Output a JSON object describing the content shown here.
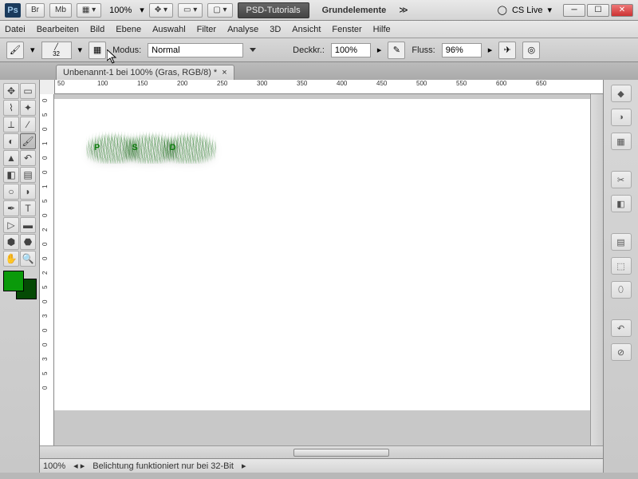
{
  "app": {
    "zoom": "100%",
    "workspace1": "PSD-Tutorials",
    "workspace2": "Grundelemente",
    "cslive": "CS Live"
  },
  "menu": [
    "Datei",
    "Bearbeiten",
    "Bild",
    "Ebene",
    "Auswahl",
    "Filter",
    "Analyse",
    "3D",
    "Ansicht",
    "Fenster",
    "Hilfe"
  ],
  "options": {
    "brushSize": "32",
    "modeLabel": "Modus:",
    "mode": "Normal",
    "opacityLabel": "Deckkr.:",
    "opacity": "100%",
    "flowLabel": "Fluss:",
    "flow": "96%"
  },
  "doc": {
    "tab": "Unbenannt-1 bei 100% (Gras, RGB/8) *"
  },
  "colors": {
    "fg": "#0a9a0a",
    "bg": "#054a05"
  },
  "status": {
    "zoom": "100%",
    "msg": "Belichtung funktioniert nur bei 32-Bit"
  },
  "rulerH": [
    "50",
    "100",
    "150",
    "200",
    "250",
    "300",
    "350",
    "400",
    "450",
    "500",
    "550",
    "600",
    "650"
  ],
  "rulerV": [
    "0",
    "5",
    "0",
    "1",
    "0",
    "0",
    "1",
    "5",
    "0",
    "2",
    "0",
    "0",
    "2",
    "5",
    "0",
    "3",
    "0",
    "0",
    "3",
    "5",
    "0"
  ],
  "canvasText": [
    "P",
    "S",
    "D"
  ]
}
